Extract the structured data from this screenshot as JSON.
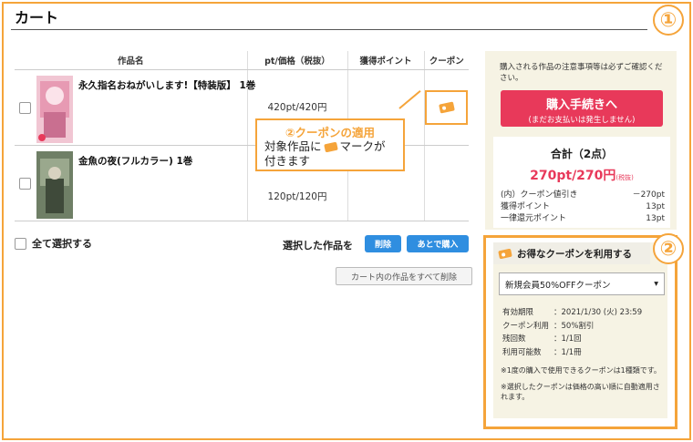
{
  "header": {
    "title": "カート"
  },
  "markers": {
    "one": "①",
    "two": "②"
  },
  "table": {
    "headers": [
      "作品名",
      "pt/価格（税抜）",
      "獲得ポイント",
      "クーポン"
    ],
    "rows": [
      {
        "name": "永久指名おねがいします!【特装版】 1巻",
        "price": "420pt/420円",
        "points": "",
        "coupon": true
      },
      {
        "name": "金魚の夜(フルカラー) 1巻",
        "price": "120pt/120円",
        "points": "",
        "coupon": false
      }
    ]
  },
  "callout": {
    "title": "②クーポンの適用",
    "line1_pre": "対象作品に",
    "line1_post": "マークが",
    "line2": "付きます"
  },
  "actions": {
    "select_all": "全て選択する",
    "selected_label": "選択した作品を",
    "delete": "削除",
    "buy_later": "あとで購入",
    "clear_all": "カート内の作品をすべて削除"
  },
  "summary": {
    "notice": "購入される作品の注意事項等は必ずご確認ください。",
    "checkout_main": "購入手続きへ",
    "checkout_sub": "(まだお支払いは発生しません)",
    "total_head": "合計（2点）",
    "total_value": "270pt/270円",
    "tax_note": "(税抜)",
    "breakdown": [
      {
        "label": "(内）クーポン値引き",
        "value": "－270pt"
      },
      {
        "label": "獲得ポイント",
        "value": "13pt"
      },
      {
        "label": "一律還元ポイント",
        "value": "13pt"
      }
    ]
  },
  "coupon": {
    "head": "お得なクーポンを利用する",
    "selected": "新規会員50%OFFクーポン",
    "details": [
      {
        "k": "有効期限",
        "v": "：2021/1/30 (火) 23:59"
      },
      {
        "k": "クーポン利用",
        "v": "：50%割引"
      },
      {
        "k": "残回数",
        "v": "：1/1回"
      },
      {
        "k": "利用可能数",
        "v": "：1/1冊"
      }
    ],
    "note1": "※1度の購入で使用できるクーポンは1種類です。",
    "note2": "※選択したクーポンは価格の高い順に自動適用されます。"
  },
  "colors": {
    "accent": "#f5a43a",
    "checkout": "#e8395a",
    "button": "#2f8ee0",
    "panel": "#f6f3e4"
  }
}
